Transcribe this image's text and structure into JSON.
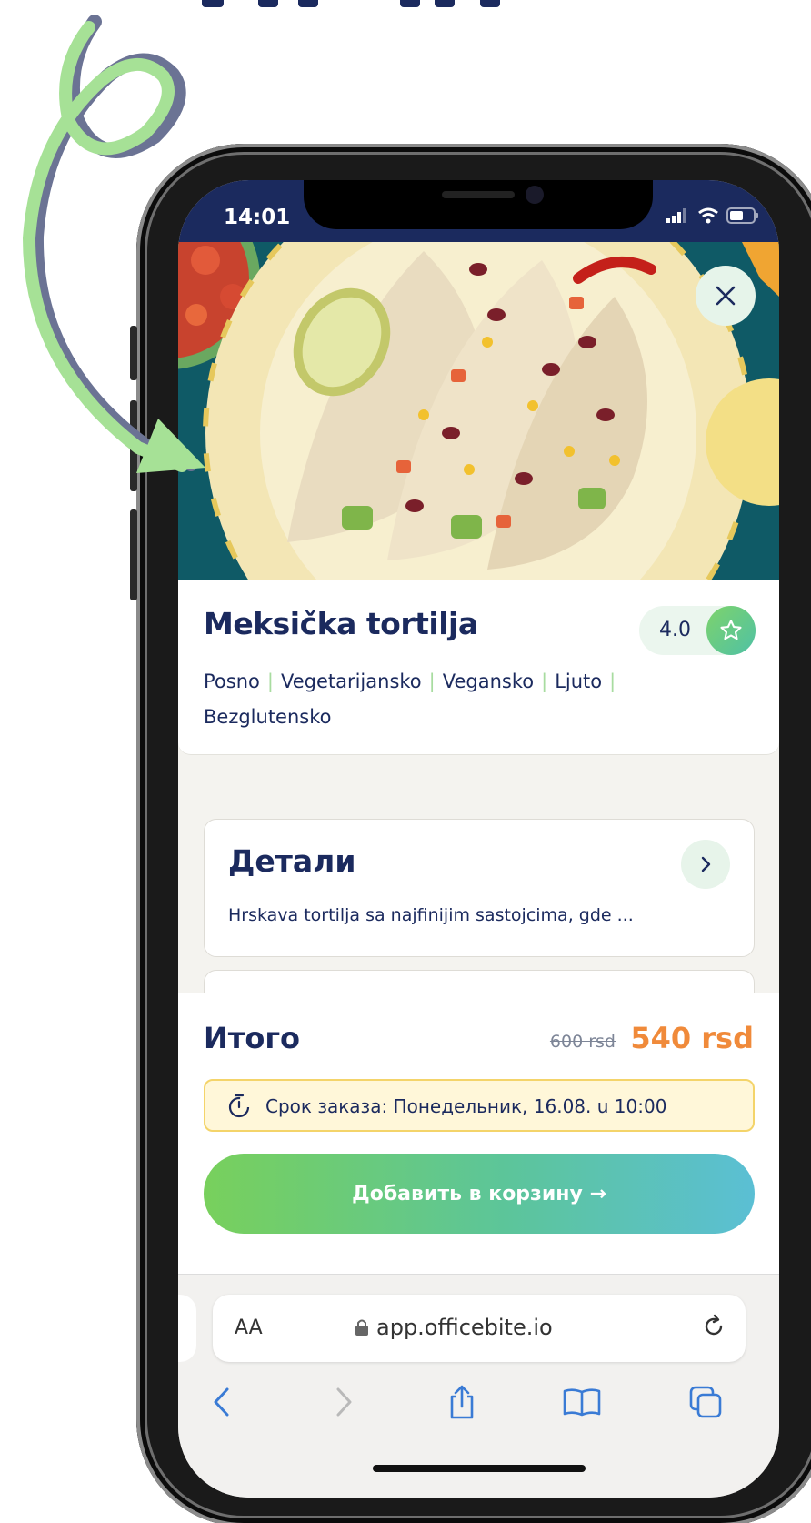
{
  "status_bar": {
    "time": "14:01"
  },
  "product": {
    "name": "Meksička tortilja",
    "rating": "4.0",
    "tags": [
      "Posno",
      "Vegetarijansko",
      "Vegansko",
      "Ljuto",
      "Bezglutensko"
    ]
  },
  "details": {
    "title": "Детали",
    "description": "Hrskava tortilja sa najfinijim sastojcima, gde ..."
  },
  "checkout": {
    "total_label": "Итого",
    "old_price": "600 rsd",
    "new_price": "540 rsd",
    "deadline": "Срок заказа: Понедельник, 16.08. u 10:00",
    "add_to_cart": "Добавить в корзину →"
  },
  "browser": {
    "text_size": "AA",
    "url": "app.officebite.io"
  },
  "colors": {
    "brand_navy": "#1b2a5e",
    "accent_green": "#78d05c",
    "price_orange": "#f08a3a"
  }
}
